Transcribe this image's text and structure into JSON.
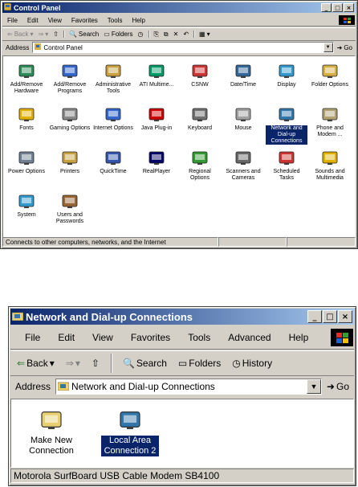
{
  "window1": {
    "title": "Control Panel",
    "menu": [
      "File",
      "Edit",
      "View",
      "Favorites",
      "Tools",
      "Help"
    ],
    "toolbar": {
      "back": "Back",
      "forward": "",
      "up": "",
      "search": "Search",
      "folders": "Folders",
      "history": "",
      "views": ""
    },
    "address_label": "Address",
    "address_value": "Control Panel",
    "go_label": "Go",
    "items": [
      {
        "label": "Add/Remove Hardware",
        "icon": "add-remove-hardware-icon",
        "color": "#2e8b57"
      },
      {
        "label": "Add/Remove Programs",
        "icon": "add-remove-programs-icon",
        "color": "#3366cc"
      },
      {
        "label": "Administrative Tools",
        "icon": "administrative-tools-icon",
        "color": "#c8a040"
      },
      {
        "label": "ATI Multime...",
        "icon": "ati-multimedia-icon",
        "color": "#009966"
      },
      {
        "label": "CSNW",
        "icon": "csnw-icon",
        "color": "#cc3333"
      },
      {
        "label": "Date/Time",
        "icon": "date-time-icon",
        "color": "#336699"
      },
      {
        "label": "Display",
        "icon": "display-icon",
        "color": "#3399cc"
      },
      {
        "label": "Folder Options",
        "icon": "folder-options-icon",
        "color": "#d4b040"
      },
      {
        "label": "Fonts",
        "icon": "fonts-icon",
        "color": "#e0b000"
      },
      {
        "label": "Gaming Options",
        "icon": "gaming-options-icon",
        "color": "#888888"
      },
      {
        "label": "Internet Options",
        "icon": "internet-options-icon",
        "color": "#3366cc"
      },
      {
        "label": "Java Plug-in",
        "icon": "java-plugin-icon",
        "color": "#cc0000"
      },
      {
        "label": "Keyboard",
        "icon": "keyboard-icon",
        "color": "#707070"
      },
      {
        "label": "Mouse",
        "icon": "mouse-icon",
        "color": "#a0a0a0"
      },
      {
        "label": "Network and Dial-up Connections",
        "icon": "network-connections-icon",
        "color": "#3377aa",
        "selected": true
      },
      {
        "label": "Phone and Modem ...",
        "icon": "phone-modem-icon",
        "color": "#b0a070"
      },
      {
        "label": "Power Options",
        "icon": "power-options-icon",
        "color": "#708090"
      },
      {
        "label": "Printers",
        "icon": "printers-icon",
        "color": "#c8a040"
      },
      {
        "label": "QuickTime",
        "icon": "quicktime-icon",
        "color": "#3355aa"
      },
      {
        "label": "RealPlayer",
        "icon": "realplayer-icon",
        "color": "#000066"
      },
      {
        "label": "Regional Options",
        "icon": "regional-options-icon",
        "color": "#339933"
      },
      {
        "label": "Scanners and Cameras",
        "icon": "scanners-cameras-icon",
        "color": "#666666"
      },
      {
        "label": "Scheduled Tasks",
        "icon": "scheduled-tasks-icon",
        "color": "#cc3333"
      },
      {
        "label": "Sounds and Multimedia",
        "icon": "sounds-multimedia-icon",
        "color": "#e0b000"
      },
      {
        "label": "System",
        "icon": "system-icon",
        "color": "#3399cc"
      },
      {
        "label": "Users and Passwords",
        "icon": "users-passwords-icon",
        "color": "#996633"
      }
    ],
    "status": "Connects to other computers, networks, and the Internet"
  },
  "window2": {
    "title": "Network and Dial-up Connections",
    "menu": [
      "File",
      "Edit",
      "View",
      "Favorites",
      "Tools",
      "Advanced",
      "Help"
    ],
    "toolbar": {
      "back": "Back",
      "forward": "",
      "up": "",
      "search": "Search",
      "folders": "Folders",
      "history": "History"
    },
    "address_label": "Address",
    "address_value": "Network and Dial-up Connections",
    "go_label": "Go",
    "items": [
      {
        "label": "Make New Connection",
        "icon": "make-new-connection-icon",
        "color": "#e8d070"
      },
      {
        "label": "Local Area Connection 2",
        "icon": "local-area-connection-icon",
        "color": "#3377aa",
        "selected": true
      }
    ],
    "status": "Motorola SurfBoard USB Cable Modem SB4100"
  },
  "colors": {
    "titlebar": "#0a246a",
    "face": "#d4d0c8",
    "selection": "#0a246a"
  }
}
